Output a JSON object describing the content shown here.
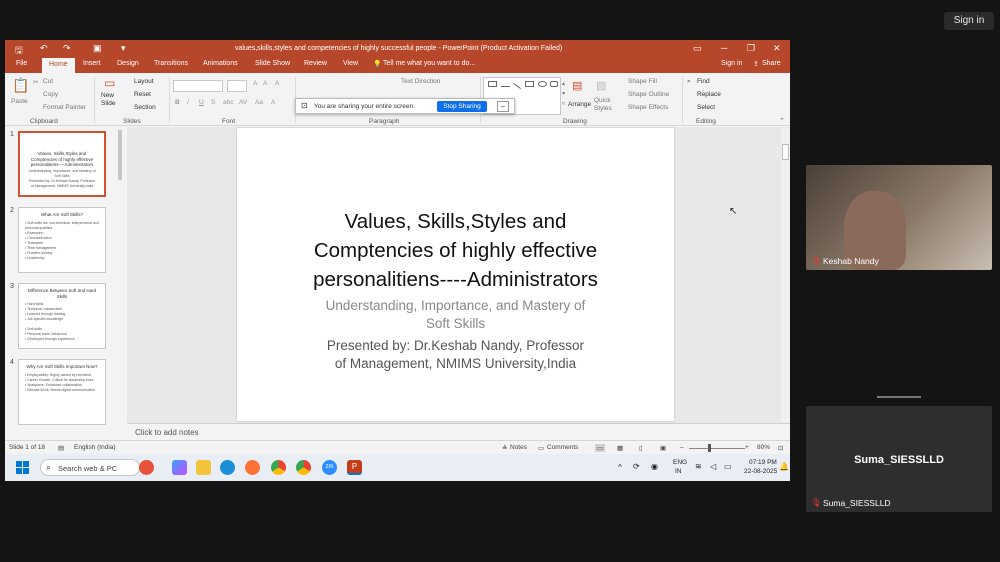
{
  "zoom": {
    "signin": "Sign in"
  },
  "ppt": {
    "title": "values,skills,styles and competencies of highly successful people - PowerPoint (Product Activation Failed)",
    "tabs": [
      "File",
      "Home",
      "Insert",
      "Design",
      "Transitions",
      "Animations",
      "Slide Show",
      "Review",
      "View"
    ],
    "tell_me": "Tell me what you want to do...",
    "signin": "Sign in",
    "share": "Share",
    "ribbon": {
      "paste": "Paste",
      "cut": "Cut",
      "copy": "Copy",
      "format_painter": "Format Painter",
      "clipboard": "Clipboard",
      "new_slide": "New\nSlide",
      "layout": "Layout",
      "reset": "Reset",
      "section": "Section",
      "slides": "Slides",
      "font": "Font",
      "text_direction": "Text Direction",
      "paragraph": "Paragraph",
      "arrange": "Arrange",
      "quick_styles": "Quick\nStyles",
      "shape_fill": "Shape Fill",
      "shape_outline": "Shape Outline",
      "shape_effects": "Shape Effects",
      "drawing": "Drawing",
      "find": "Find",
      "replace": "Replace",
      "select": "Select",
      "editing": "Editing"
    },
    "share_bar": {
      "message": "You are sharing your entire screen.",
      "stop": "Stop Sharing"
    },
    "thumbnails": [
      {
        "num": "1",
        "title": "Values, Skills,Styles and\nComptencies of highly effective\npersonalitiens----Administrators",
        "body": "Understanding, Importance, and Mastery of\nSoft Skills\nPresented by: Dr.Keshab Nandy, Professor\nof Management, NMIMS University,India"
      },
      {
        "num": "2",
        "title": "What Are Soft Skills?",
        "body": "• Soft skills are non-technical, interpersonal and\n  personal qualities\n• Examples:\n• Communication\n• Teamwork\n• Time management\n• Problem-solving\n• Leadership"
      },
      {
        "num": "3",
        "title": "Difference Between Soft and Hard\nSkills",
        "body": "• Hard skills\n• Technical, measurable\n• Learned through training\n• Job specific knowledge\n\n• Soft skills\n• Personal traits, behaviour\n• Developed through experience"
      },
      {
        "num": "4",
        "title": "Why Are Soft Skills Important Now?",
        "body": "• Employability: Highly valued by recruiters\n• Career Growth: Critical for leadership roles\n• Workplace: Enhances collaboration\n• Remote Work: Needs digital communication"
      }
    ],
    "slide": {
      "title": "Values, Skills,Styles and\nComptencies of highly effective\npersonalitiens----Administrators",
      "subtitle": "Understanding, Importance, and Mastery of\nSoft Skills",
      "presenter": "Presented by:  Dr.Keshab Nandy, Professor\nof Management, NMIMS University,India"
    },
    "notes_placeholder": "Click to add notes",
    "status": {
      "slide_count": "Slide 1 of 18",
      "language": "English (India)",
      "notes": "Notes",
      "comments": "Comments",
      "zoom_level": "80%"
    }
  },
  "taskbar": {
    "search": "Search web & PC",
    "lang": "ENG",
    "region": "IN",
    "time": "07:19 PM",
    "date": "22-08-2025"
  },
  "participants": [
    {
      "name": "Keshab Nandy"
    },
    {
      "name": "Suma_SIESSLLD"
    }
  ],
  "colors": {
    "ppt_accent": "#b7472a",
    "stop_button": "#0e71eb",
    "muted_icon": "#e33333"
  }
}
